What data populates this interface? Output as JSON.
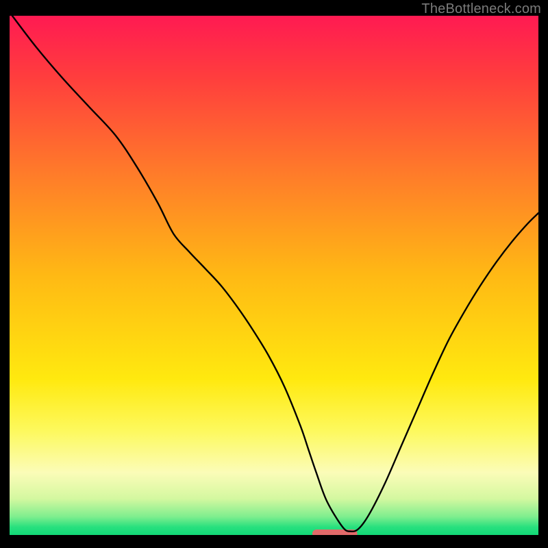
{
  "attribution": "TheBottleneck.com",
  "chart_data": {
    "type": "line",
    "title": "",
    "xlabel": "",
    "ylabel": "",
    "xlim": [
      0,
      100
    ],
    "ylim": [
      0,
      100
    ],
    "background_gradient": {
      "stops": [
        {
          "offset": 0.0,
          "color": "#ff1a52"
        },
        {
          "offset": 0.12,
          "color": "#ff3e3d"
        },
        {
          "offset": 0.3,
          "color": "#ff7a2a"
        },
        {
          "offset": 0.5,
          "color": "#ffb914"
        },
        {
          "offset": 0.7,
          "color": "#ffe90f"
        },
        {
          "offset": 0.8,
          "color": "#fdf95e"
        },
        {
          "offset": 0.88,
          "color": "#fbfcb8"
        },
        {
          "offset": 0.93,
          "color": "#d4f8a0"
        },
        {
          "offset": 0.965,
          "color": "#7eee8e"
        },
        {
          "offset": 0.985,
          "color": "#27e07e"
        },
        {
          "offset": 1.0,
          "color": "#12d977"
        }
      ]
    },
    "series": [
      {
        "name": "bottleneck-curve",
        "x": [
          0.5,
          5,
          10,
          15,
          20,
          24,
          28,
          31,
          34,
          37,
          40,
          43,
          46,
          49,
          52,
          55,
          56.5,
          58,
          60,
          63,
          64.5,
          66,
          68,
          71,
          74,
          77,
          80,
          83,
          86,
          89,
          92,
          95,
          98,
          100
        ],
        "y": [
          100,
          94,
          88,
          82.5,
          77,
          71,
          64,
          58,
          54.5,
          51.3,
          48,
          44,
          39.5,
          34.5,
          28.5,
          21,
          16.5,
          12,
          6.5,
          1.5,
          0.7,
          1.2,
          4,
          10,
          17,
          24,
          31,
          37.5,
          43,
          48,
          52.5,
          56.5,
          60,
          62
        ]
      }
    ],
    "marker": {
      "name": "optimal-zone",
      "shape": "rounded-bar",
      "color": "#e26a6a",
      "x_center": 61.5,
      "y": 0.25,
      "width_pct": 8.5,
      "height_pct": 1.6
    }
  }
}
